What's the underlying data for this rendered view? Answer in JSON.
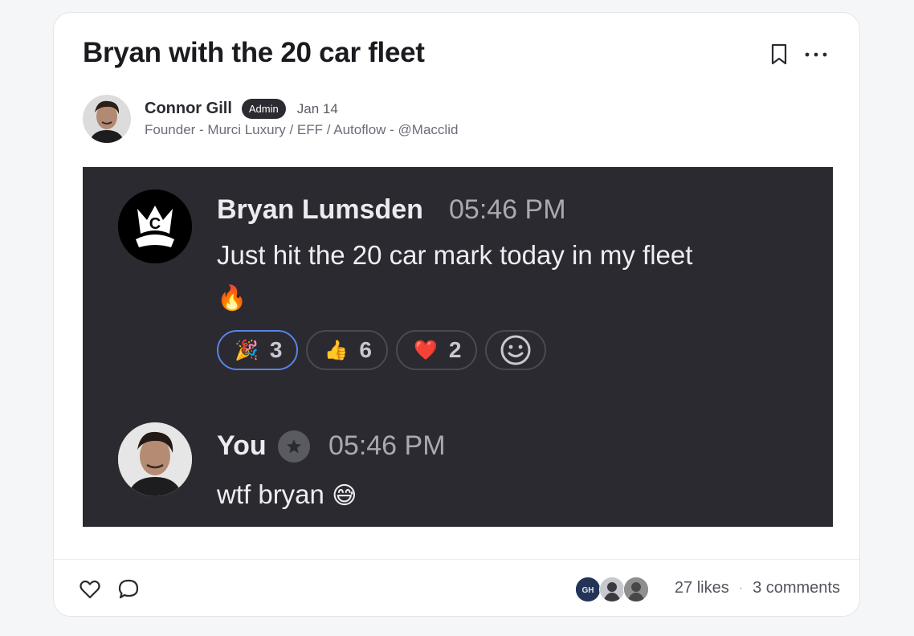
{
  "post": {
    "title": "Bryan with the 20 car fleet",
    "author": {
      "name": "Connor Gill",
      "badge": "Admin",
      "date": "Jan 14",
      "tagline": "Founder - Murci Luxury / EFF / Autoflow - @Macclid"
    },
    "icons": {
      "bookmark": "bookmark-icon",
      "more": "more-horizontal-icon",
      "like": "heart-icon",
      "comment": "comment-bubble-icon"
    },
    "stats": {
      "likes": "27 likes",
      "separator": "·",
      "comments": "3 comments"
    }
  },
  "screenshot": {
    "messages": [
      {
        "name": "Bryan Lumsden",
        "time": "05:46 PM",
        "text": "Just hit the 20 car mark today in my fleet",
        "emoji": "🔥",
        "avatar": "crown-logo-avatar"
      },
      {
        "name": "You",
        "time": "05:46 PM",
        "text": "wtf bryan",
        "emoji": "😅",
        "avatar": "user-photo-avatar"
      }
    ],
    "reactions": [
      {
        "emoji": "🎉",
        "count": "3",
        "active": true
      },
      {
        "emoji": "👍",
        "count": "6",
        "active": false
      },
      {
        "emoji": "❤️",
        "count": "2",
        "active": false
      }
    ],
    "colors": {
      "background": "#2b2a30",
      "active_reaction_border": "#5a84e6"
    }
  }
}
